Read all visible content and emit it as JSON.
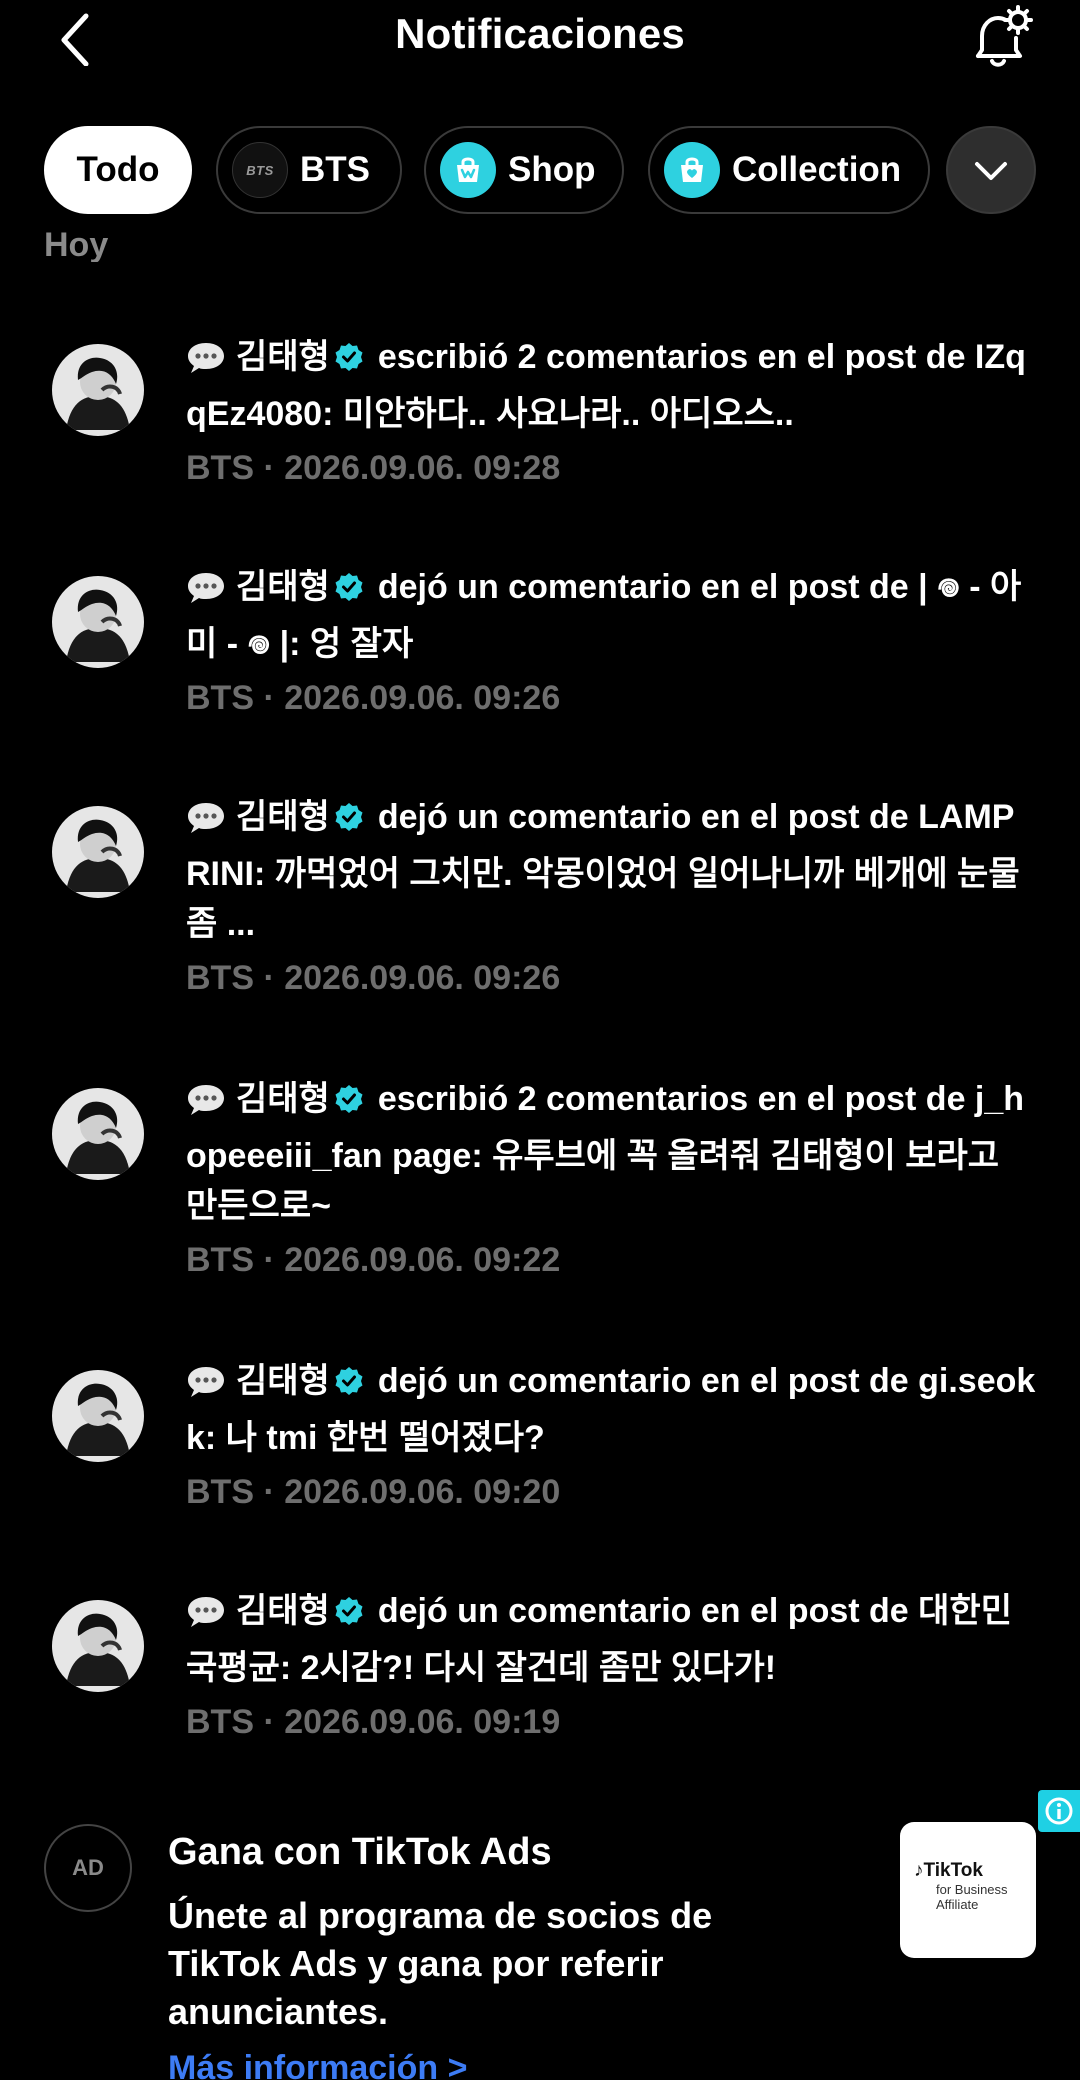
{
  "header": {
    "title": "Notificaciones",
    "back_icon": "chevron-left-icon",
    "settings_icon": "bell-settings-icon"
  },
  "filters": [
    {
      "label": "Todo",
      "active": true
    },
    {
      "label": "BTS",
      "icon": "bts-logo",
      "icon_text": "BTS"
    },
    {
      "label": "Shop",
      "icon": "shopping-bag-icon"
    },
    {
      "label": "Collection",
      "icon": "collection-bag-icon"
    }
  ],
  "filters_more_icon": "chevron-down-icon",
  "section_label": "Hoy",
  "notifications": [
    {
      "author": "김태형",
      "message": "escribió 2 comentarios en el post de IZqqEz4080: 미안하다.. 사요나라.. 아디오스..",
      "meta": "BTS · 2026.09.06. 09:28"
    },
    {
      "author": "김태형",
      "message": "dejó un comentario en el post de | 𖦹 - 아미 - 𖦹 |: 엉 잘자",
      "meta": "BTS · 2026.09.06. 09:26"
    },
    {
      "author": "김태형",
      "message": "dejó un comentario en el post de LAMPRINI: 까먹었어 그치만. 악몽이었어 일어나니까 베개에 눈물좀 ...",
      "meta": "BTS · 2026.09.06. 09:26"
    },
    {
      "author": "김태형",
      "message": "escribió 2 comentarios en el post de j_hopeeeiii_fan page: 유투브에 꼭 올려줘 김태형이 보라고 만든으로~",
      "meta": "BTS · 2026.09.06. 09:22"
    },
    {
      "author": "김태형",
      "message": "dejó un comentario en el post de gi.seokk: 나 tmi 한번 떨어졌다?",
      "meta": "BTS · 2026.09.06. 09:20"
    },
    {
      "author": "김태형",
      "message": "dejó un comentario en el post de 대한민국평균: 2시감?! 다시 잘건데 좀만 있다가!",
      "meta": "BTS · 2026.09.06. 09:19"
    }
  ],
  "ad": {
    "avatar_text": "AD",
    "title": "Gana con TikTok Ads",
    "description": "Únete al programa de socios de TikTok Ads y gana por referir anunciantes.",
    "link": "Más información >",
    "image_brand": "TikTok",
    "image_sub1": "for Business",
    "image_sub2": "Affiliate"
  },
  "colors": {
    "background": "#000000",
    "verified": "#2ed1e0",
    "meta_text": "#6e6e6e",
    "link": "#3d7cf5",
    "chip_border": "#3a3a3a"
  }
}
